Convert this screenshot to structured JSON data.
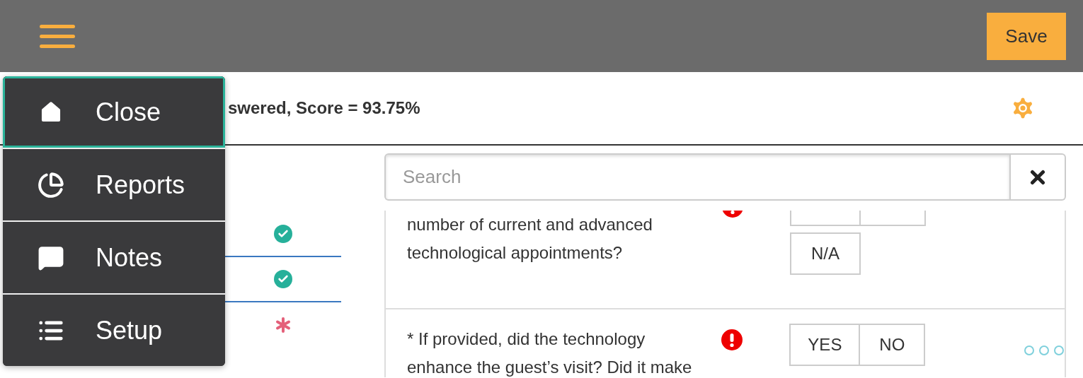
{
  "header": {
    "save_button": "Save"
  },
  "menu": {
    "items": [
      {
        "label": "Close",
        "kind": "home",
        "selected": true
      },
      {
        "label": "Reports",
        "kind": "pie",
        "selected": false
      },
      {
        "label": "Notes",
        "kind": "chat",
        "selected": false
      },
      {
        "label": "Setup",
        "kind": "list",
        "selected": false
      }
    ]
  },
  "summary": {
    "score_text": "swered, Score = 93.75%"
  },
  "checklist": {
    "rows": [
      {
        "kind": "done"
      },
      {
        "kind": "done"
      },
      {
        "kind": "required"
      }
    ]
  },
  "search": {
    "placeholder": "Search"
  },
  "questions": [
    {
      "text": "number of current and advanced technological appointments?",
      "required": true,
      "clipped": true,
      "options": [
        "N/A"
      ],
      "more": false
    },
    {
      "text": "* If provided, did the technology enhance the guest’s visit? Did it make",
      "required": true,
      "clipped": false,
      "options": [
        "YES",
        "NO"
      ],
      "more": true
    }
  ]
}
